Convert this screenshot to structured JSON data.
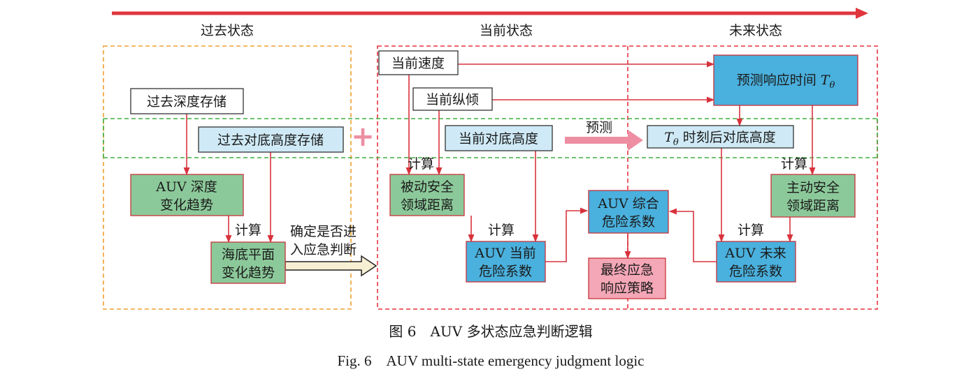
{
  "colors": {
    "timeline": "#e0353d",
    "past_frame": "#f0a030",
    "present_frame": "#e8343f",
    "band": "#3fae3f",
    "arrow": "#d8333d",
    "green_box": "#8cc99a",
    "blue_box": "#4ab0dd",
    "lightblue_box": "#cfeaf6",
    "pink_box": "#f4a7b6",
    "predict_arrow": "#ee8ea2"
  },
  "headers": {
    "past": "过去状态",
    "present": "当前状态",
    "future": "未来状态"
  },
  "boxes": {
    "past_depth_storage": "过去深度存储",
    "past_height_storage": "过去对底高度存储",
    "auv_depth_trend": [
      "AUV 深度",
      "变化趋势"
    ],
    "seabed_trend": [
      "海底平面",
      "变化趋势"
    ],
    "current_speed": "当前速度",
    "current_pitch": "当前纵倾",
    "current_height": "当前对底高度",
    "passive_safety": [
      "被动安全",
      "领域距离"
    ],
    "current_danger": [
      "AUV 当前",
      "危险系数"
    ],
    "combined_danger": [
      "AUV 综合",
      "危险系数"
    ],
    "final_strategy": [
      "最终应急",
      "响应策略"
    ],
    "predict_time": {
      "text": "预测响应时间 ",
      "symbol": "T",
      "sub": "θ"
    },
    "future_height": {
      "symbol": "T",
      "sub": "θ",
      "text": " 时刻后对底高度"
    },
    "active_safety": [
      "主动安全",
      "领域距离"
    ],
    "future_danger": [
      "AUV 未来",
      "危险系数"
    ]
  },
  "labels": {
    "calc": "计算",
    "predict": "预测",
    "plus": "+",
    "decide": [
      "确定是否进",
      "入应急判断"
    ]
  },
  "caption": {
    "zh": "图 6　AUV 多状态应急判断逻辑",
    "en": "Fig. 6　AUV multi-state emergency judgment logic"
  }
}
